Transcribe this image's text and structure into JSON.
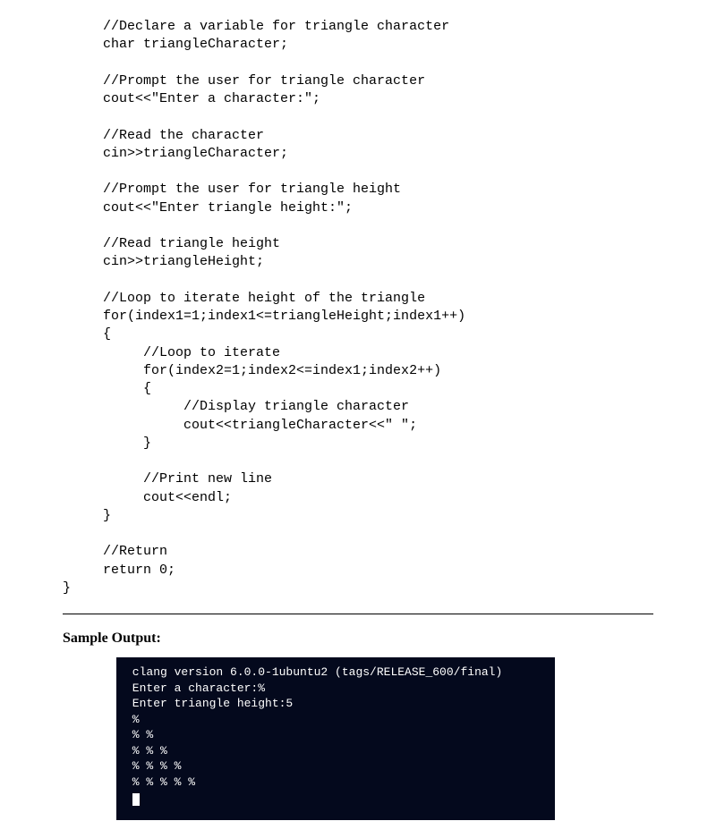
{
  "code": {
    "lines": "     //Declare a variable for triangle character\n     char triangleCharacter;\n\n     //Prompt the user for triangle character\n     cout<<\"Enter a character:\";\n\n     //Read the character\n     cin>>triangleCharacter;\n\n     //Prompt the user for triangle height\n     cout<<\"Enter triangle height:\";\n\n     //Read triangle height\n     cin>>triangleHeight;\n\n     //Loop to iterate height of the triangle\n     for(index1=1;index1<=triangleHeight;index1++)\n     {\n          //Loop to iterate\n          for(index2=1;index2<=index1;index2++)\n          {\n               //Display triangle character\n               cout<<triangleCharacter<<\" \";\n          }\n\n          //Print new line\n          cout<<endl;\n     }\n\n     //Return\n     return 0;\n}"
  },
  "sample_label": "Sample Output:",
  "terminal": {
    "text": " clang version 6.0.0-1ubuntu2 (tags/RELEASE_600/final)\n Enter a character:%\n Enter triangle height:5\n %\n % %\n % % %\n % % % %\n % % % % %\n "
  }
}
